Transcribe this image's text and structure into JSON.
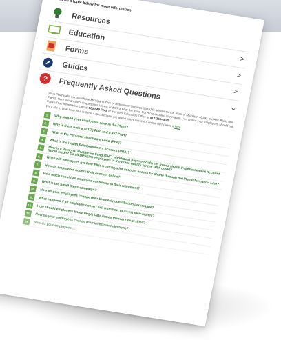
{
  "intro": "Click on a topic below for more information",
  "topics": [
    {
      "label": "Resources",
      "icon": "lightbulb-icon",
      "chevron": ""
    },
    {
      "label": "Education",
      "icon": "monitor-icon",
      "chevron": ">"
    },
    {
      "label": "Forms",
      "icon": "pdf-document-icon",
      "chevron": ">"
    },
    {
      "label": "Guides",
      "icon": "compass-icon",
      "chevron": ">"
    },
    {
      "label": "Frequently Asked Questions",
      "icon": "question-circle-icon",
      "chevron": "⌄"
    }
  ],
  "faq": {
    "description_1": "Voya Financial® works with the Michigan Office of Retirement Services (ORS) to administer the State of Michigan 401(k) and 457 Plans (the Plans). Here are answers to questions Voya® and ORS hear the most. For more detailed information, you and/or your employees should call Voya's Plan Information Line at",
    "phone_1": "800-649-7148",
    "description_2": "or the Voya Education Office at",
    "phone_2": "517-286-4822",
    "prompt": "We'd like to hear from you! Is there a question you get asked often, but is not on the list? Leave it",
    "prompt_link": "here",
    "questions": [
      {
        "num": "1.",
        "text": "Why should your employees save in the Plans?"
      },
      {
        "num": "2.",
        "text": "Why is there both a 401(k) Plan and a 457 Plan?"
      },
      {
        "num": "3.",
        "text": "What is the Personal Healthcare Fund (PHF)?"
      },
      {
        "num": "4.",
        "text": "What is the Health Reimbursement Account (HRA)?"
      },
      {
        "num": "5.",
        "text": "How is a Personal Healthcare Fund (PHF) withdrawal payment different from a Health Reimbursement Account (HRA) credit? Do all DPSERS employees in the Plans qualify for the HRA credit?"
      },
      {
        "num": "6.",
        "text": "When will employees get their PINs from Voya for account access by phone through the Plan Information Line?"
      },
      {
        "num": "7.",
        "text": "How do employees access their account online?"
      },
      {
        "num": "8.",
        "text": "How much should an employee contribute to their retirement?"
      },
      {
        "num": "9.",
        "text": "What is the Small Steps campaign?"
      },
      {
        "num": "10.",
        "text": "How do your employees change their bi-weekly contribution percentage?"
      },
      {
        "num": "11.",
        "text": "What happens if an employee doesn't sell from how to invest their money?"
      },
      {
        "num": "12.",
        "text": "How should employees know Target Date Funds them are diversified?"
      },
      {
        "num": "13.",
        "text": "How do your employees change their investment elections?"
      },
      {
        "num": "14.",
        "text": "How do your employees ..."
      }
    ]
  },
  "colors": {
    "accent_green": "#6aa84f",
    "link_green": "#2f7d32",
    "band": "#cfd4dc",
    "brand_blue": "#2a7bd3"
  }
}
